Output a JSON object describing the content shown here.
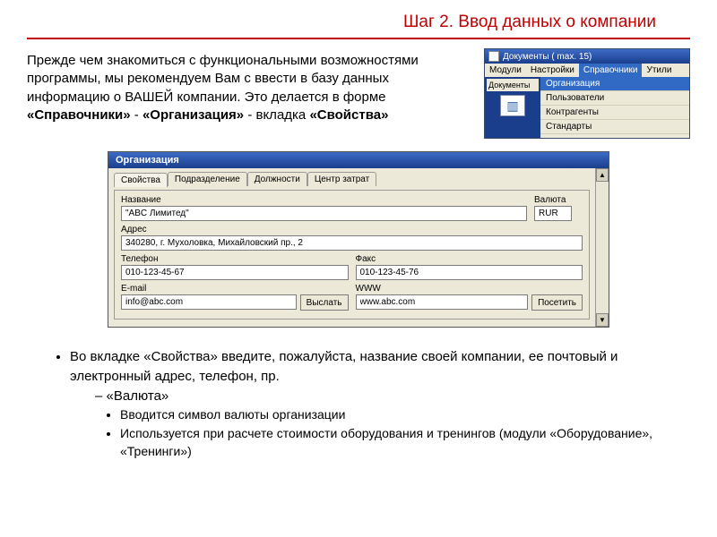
{
  "title": "Шаг 2. Ввод данных о компании",
  "intro": {
    "pre": "Прежде чем знакомиться с функциональными возможностями программы, мы рекомендуем Вам с ввести в базу данных информацию о ВАШЕЙ компании. Это делается в форме ",
    "b1": "«Справочники»",
    "dash1": " - ",
    "b2": "«Организация»",
    "dash2": " - вкладка ",
    "b3": "«Свойства»"
  },
  "mini": {
    "title": "Документы ( max. 15)",
    "menubar": [
      "Модули",
      "Настройки",
      "Справочники",
      "Утили"
    ],
    "left_top": "Документы",
    "drop": [
      "Организация",
      "Пользователи",
      "Контрагенты",
      "Стандарты"
    ]
  },
  "dialog": {
    "title": "Организация",
    "tabs": [
      "Свойства",
      "Подразделение",
      "Должности",
      "Центр затрат"
    ],
    "labels": {
      "name": "Название",
      "currency": "Валюта",
      "address": "Адрес",
      "phone": "Телефон",
      "fax": "Факс",
      "email": "E-mail",
      "www": "WWW"
    },
    "values": {
      "name": "\"ABC Лимитед\"",
      "currency": "RUR",
      "address": "340280, г. Мухоловка, Михайловский пр., 2",
      "phone": "010-123-45-67",
      "fax": "010-123-45-76",
      "email": "info@abc.com",
      "www": "www.abc.com"
    },
    "buttons": {
      "send": "Выслать",
      "visit": "Посетить"
    }
  },
  "bullets": {
    "l1": "Во вкладке «Свойства» введите, пожалуйста, название своей компании, ее почтовый и электронный адрес, телефон, пр.",
    "l2": "«Валюта»",
    "l3a": "Вводится символ валюты организации",
    "l3b": "Используется при расчете стоимости оборудования и тренингов (модули «Оборудование», «Тренинги»)"
  }
}
